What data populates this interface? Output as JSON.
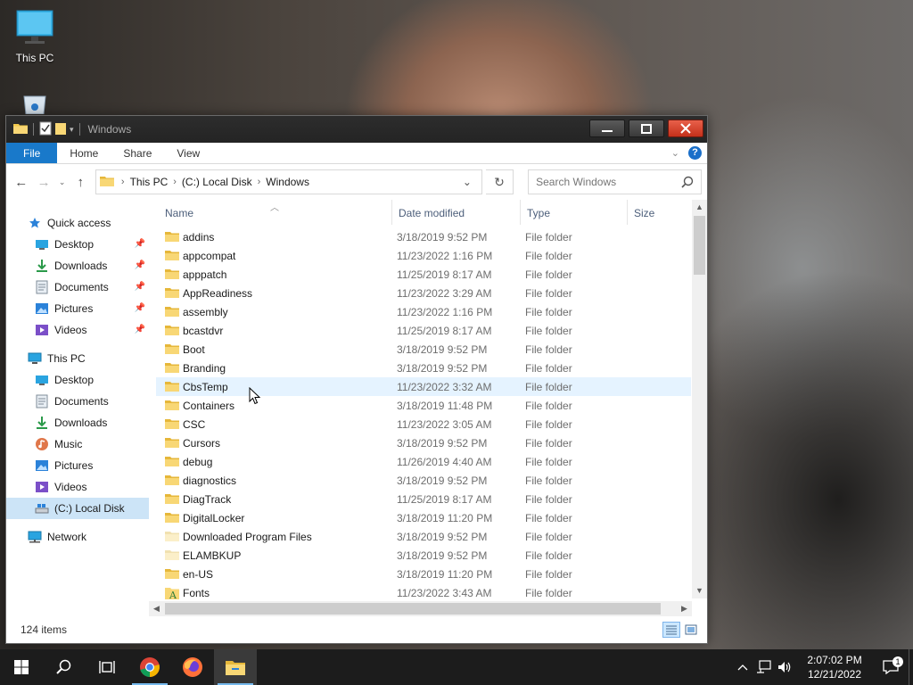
{
  "desktop": {
    "icons": [
      {
        "label": "This PC",
        "icon": "monitor-icon"
      },
      {
        "label": "",
        "icon": "recycle-bin-icon"
      }
    ]
  },
  "window": {
    "title": "Windows",
    "ribbon_tabs": [
      "File",
      "Home",
      "Share",
      "View"
    ],
    "breadcrumb": [
      "This PC",
      "(C:) Local Disk",
      "Windows"
    ],
    "search_placeholder": "Search Windows",
    "columns": {
      "name": "Name",
      "date": "Date modified",
      "type": "Type",
      "size": "Size"
    },
    "status": "124 items"
  },
  "nav": {
    "quick_access": "Quick access",
    "quick_items": [
      {
        "label": "Desktop",
        "icon": "desktop-icon"
      },
      {
        "label": "Downloads",
        "icon": "download-icon"
      },
      {
        "label": "Documents",
        "icon": "documents-icon"
      },
      {
        "label": "Pictures",
        "icon": "pictures-icon"
      },
      {
        "label": "Videos",
        "icon": "videos-icon"
      }
    ],
    "this_pc": "This PC",
    "pc_items": [
      {
        "label": "Desktop",
        "icon": "desktop-icon"
      },
      {
        "label": "Documents",
        "icon": "documents-icon"
      },
      {
        "label": "Downloads",
        "icon": "download-icon"
      },
      {
        "label": "Music",
        "icon": "music-icon"
      },
      {
        "label": "Pictures",
        "icon": "pictures-icon"
      },
      {
        "label": "Videos",
        "icon": "videos-icon"
      },
      {
        "label": "(C:) Local Disk",
        "icon": "drive-icon"
      }
    ],
    "network": "Network"
  },
  "files": [
    {
      "name": "addins",
      "date": "3/18/2019 9:52 PM",
      "type": "File folder"
    },
    {
      "name": "appcompat",
      "date": "11/23/2022 1:16 PM",
      "type": "File folder"
    },
    {
      "name": "apppatch",
      "date": "11/25/2019 8:17 AM",
      "type": "File folder"
    },
    {
      "name": "AppReadiness",
      "date": "11/23/2022 3:29 AM",
      "type": "File folder"
    },
    {
      "name": "assembly",
      "date": "11/23/2022 1:16 PM",
      "type": "File folder"
    },
    {
      "name": "bcastdvr",
      "date": "11/25/2019 8:17 AM",
      "type": "File folder"
    },
    {
      "name": "Boot",
      "date": "3/18/2019 9:52 PM",
      "type": "File folder"
    },
    {
      "name": "Branding",
      "date": "3/18/2019 9:52 PM",
      "type": "File folder"
    },
    {
      "name": "CbsTemp",
      "date": "11/23/2022 3:32 AM",
      "type": "File folder"
    },
    {
      "name": "Containers",
      "date": "3/18/2019 11:48 PM",
      "type": "File folder"
    },
    {
      "name": "CSC",
      "date": "11/23/2022 3:05 AM",
      "type": "File folder"
    },
    {
      "name": "Cursors",
      "date": "3/18/2019 9:52 PM",
      "type": "File folder"
    },
    {
      "name": "debug",
      "date": "11/26/2019 4:40 AM",
      "type": "File folder"
    },
    {
      "name": "diagnostics",
      "date": "3/18/2019 9:52 PM",
      "type": "File folder"
    },
    {
      "name": "DiagTrack",
      "date": "11/25/2019 8:17 AM",
      "type": "File folder"
    },
    {
      "name": "DigitalLocker",
      "date": "3/18/2019 11:20 PM",
      "type": "File folder"
    },
    {
      "name": "Downloaded Program Files",
      "date": "3/18/2019 9:52 PM",
      "type": "File folder"
    },
    {
      "name": "ELAMBKUP",
      "date": "3/18/2019 9:52 PM",
      "type": "File folder"
    },
    {
      "name": "en-US",
      "date": "3/18/2019 11:20 PM",
      "type": "File folder"
    },
    {
      "name": "Fonts",
      "date": "11/23/2022 3:43 AM",
      "type": "File folder"
    }
  ],
  "taskbar": {
    "time": "2:07:02 PM",
    "date": "12/21/2022",
    "notification_count": "1"
  },
  "colors": {
    "accent": "#1979ca",
    "selected": "#cce4f7",
    "hover": "#e5f3ff"
  }
}
